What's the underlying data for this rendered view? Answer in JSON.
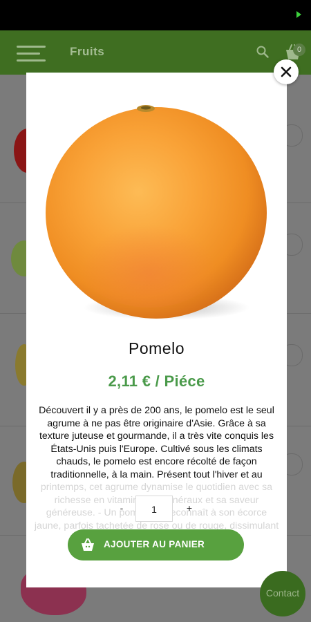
{
  "app": {
    "title": "Fruits",
    "cart_count": "0"
  },
  "icons": {
    "menu": "hamburger-icon",
    "search": "search-icon",
    "cart": "cart-icon",
    "close": "close-icon",
    "basket": "basket-icon"
  },
  "colors": {
    "appbar": "#3f6e21",
    "accent_green": "#58a13f",
    "price_green": "#4a9a4a",
    "contact_bg": "#3a6b1f"
  },
  "product": {
    "name": "Pomelo",
    "price": "2,11 € / Piéce",
    "description": "Découvert il y a près de 200 ans, le pomelo est le seul agrume à ne pas être originaire d'Asie. Grâce à sa texture juteuse et gourmande, il a très vite conquis les États-Unis puis l'Europe. Cultivé sous les climats chauds, le pomelo est encore récolté de façon traditionnelle, à la main. Présent tout l'hiver et au printemps, cet agrume dynamise le quotidien avec sa richesse en vitamines et minéraux et sa saveur généreuse. - Un pomelo se reconnaît à son écorce jaune, parfois tachetée de rose ou de rouge, dissimulant une chair allant du blond au rouge."
  },
  "quantity": {
    "minus_label": "-",
    "value": "1",
    "plus_label": "+"
  },
  "actions": {
    "add_to_cart": "AJOUTER AU PANIER",
    "contact": "Contact"
  }
}
